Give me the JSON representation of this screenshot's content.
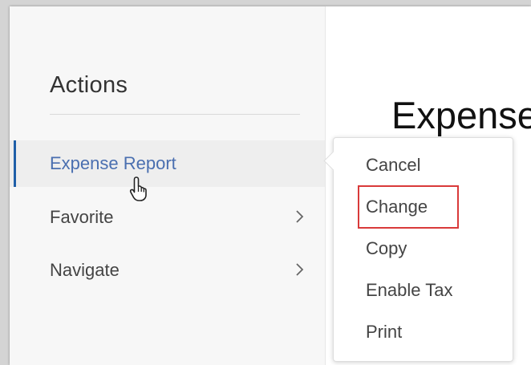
{
  "actions_panel": {
    "title": "Actions",
    "items": [
      {
        "label": "Expense Report",
        "active": true
      },
      {
        "label": "Favorite"
      },
      {
        "label": "Navigate"
      }
    ]
  },
  "main": {
    "heading": "Expense"
  },
  "popup_menu": {
    "items": [
      {
        "label": "Cancel"
      },
      {
        "label": "Change",
        "highlighted": true
      },
      {
        "label": "Copy"
      },
      {
        "label": "Enable Tax"
      },
      {
        "label": "Print"
      }
    ]
  },
  "colors": {
    "active_text": "#4a6fb0",
    "active_bar": "#1f5fa8",
    "highlight_border": "#d93a3a"
  },
  "icons": [
    "chevron-right-icon",
    "hand-pointer-cursor-icon"
  ]
}
